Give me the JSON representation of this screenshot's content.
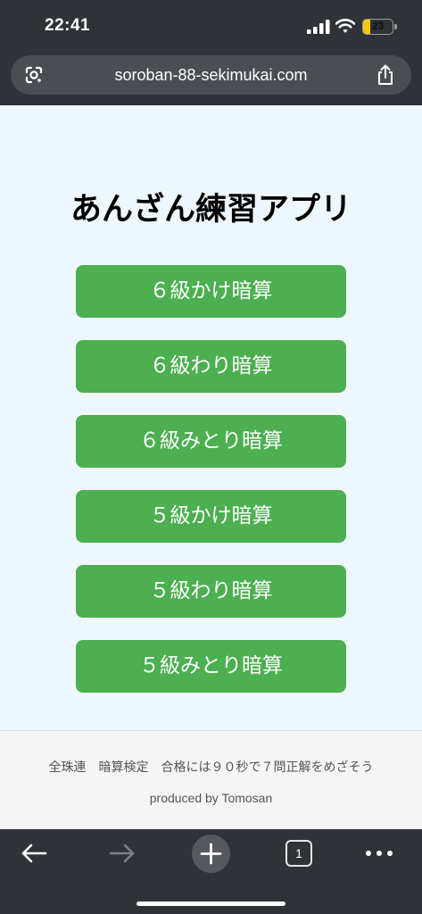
{
  "status_bar": {
    "time": "22:41",
    "battery_level": "23",
    "battery_fraction": 0.23,
    "battery_color": "#f3c70d",
    "icons": [
      "signal-icon",
      "wifi-icon",
      "battery-icon"
    ]
  },
  "browser": {
    "url": "soroban-88-sekimukai.com",
    "lens_icon": "google-lens-icon",
    "share_icon": "share-icon"
  },
  "page": {
    "title": "あんざん練習アプリ",
    "buttons": [
      {
        "label": "６級かけ暗算"
      },
      {
        "label": "６級わり暗算"
      },
      {
        "label": "６級みとり暗算"
      },
      {
        "label": "５級かけ暗算"
      },
      {
        "label": "５級わり暗算"
      },
      {
        "label": "５級みとり暗算"
      }
    ],
    "button_color": "#4caf50",
    "background_color": "#eef7fe"
  },
  "footer": {
    "note": "全珠連　暗算検定　合格には９０秒で７問正解をめざそう",
    "credit": "produced by Tomosan"
  },
  "toolbar": {
    "tab_count": "1",
    "icons": [
      "back-arrow-icon",
      "forward-arrow-icon",
      "plus-icon",
      "tabs-icon",
      "more-icon"
    ]
  }
}
